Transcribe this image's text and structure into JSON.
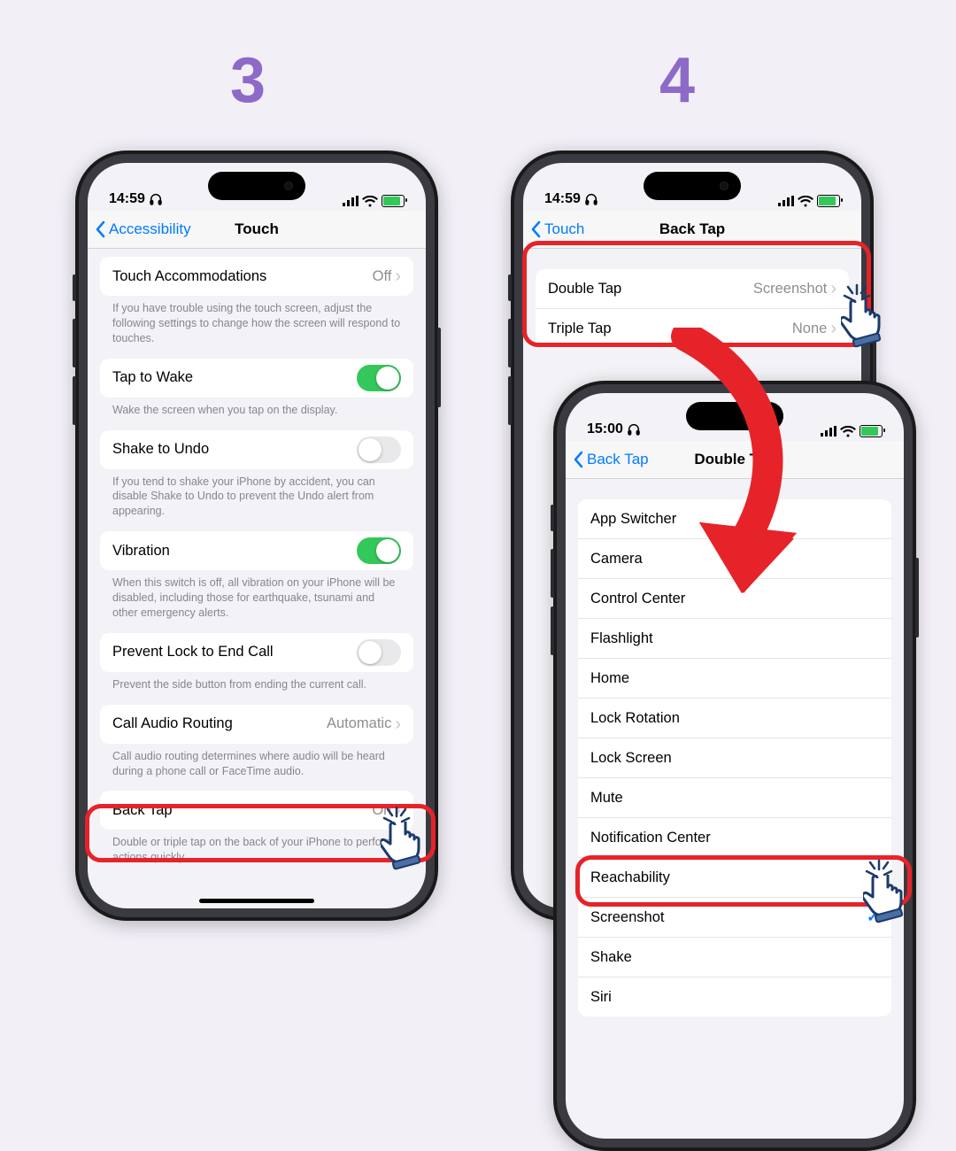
{
  "steps": {
    "left": "3",
    "right": "4"
  },
  "colors": {
    "highlight": "#e62329",
    "accent": "#8d6ac8",
    "ios_blue": "#007aff",
    "switch_on": "#34c759"
  },
  "phoneA": {
    "status_time": "14:59",
    "nav_back": "Accessibility",
    "nav_title": "Touch",
    "groups": [
      {
        "cells": [
          {
            "label": "Touch Accommodations",
            "value": "Off"
          }
        ],
        "footer": "If you have trouble using the touch screen, adjust the following settings to change how the screen will respond to touches."
      },
      {
        "cells": [
          {
            "label": "Tap to Wake",
            "switch": true
          }
        ],
        "footer": "Wake the screen when you tap on the display."
      },
      {
        "cells": [
          {
            "label": "Shake to Undo",
            "switch": false
          }
        ],
        "footer": "If you tend to shake your iPhone by accident, you can disable Shake to Undo to prevent the Undo alert from appearing."
      },
      {
        "cells": [
          {
            "label": "Vibration",
            "switch": true
          }
        ],
        "footer": "When this switch is off, all vibration on your iPhone will be disabled, including those for earthquake, tsunami and other emergency alerts."
      },
      {
        "cells": [
          {
            "label": "Prevent Lock to End Call",
            "switch": false
          }
        ],
        "footer": "Prevent the side button from ending the current call."
      },
      {
        "cells": [
          {
            "label": "Call Audio Routing",
            "value": "Automatic"
          }
        ],
        "footer": "Call audio routing determines where audio will be heard during a phone call or FaceTime audio."
      },
      {
        "cells": [
          {
            "label": "Back Tap",
            "value": "On"
          }
        ],
        "footer": "Double or triple tap on the back of your iPhone to perform actions quickly."
      }
    ]
  },
  "phoneB": {
    "status_time": "14:59",
    "nav_back": "Touch",
    "nav_title": "Back Tap",
    "cells": [
      {
        "label": "Double Tap",
        "value": "Screenshot"
      },
      {
        "label": "Triple Tap",
        "value": "None"
      }
    ]
  },
  "phoneC": {
    "status_time": "15:00",
    "nav_back": "Back Tap",
    "nav_title": "Double Tap",
    "items": [
      {
        "label": "App Switcher"
      },
      {
        "label": "Camera"
      },
      {
        "label": "Control Center"
      },
      {
        "label": "Flashlight"
      },
      {
        "label": "Home"
      },
      {
        "label": "Lock Rotation"
      },
      {
        "label": "Lock Screen"
      },
      {
        "label": "Mute"
      },
      {
        "label": "Notification Center"
      },
      {
        "label": "Reachability"
      },
      {
        "label": "Screenshot",
        "checked": true
      },
      {
        "label": "Shake"
      },
      {
        "label": "Siri"
      }
    ]
  }
}
